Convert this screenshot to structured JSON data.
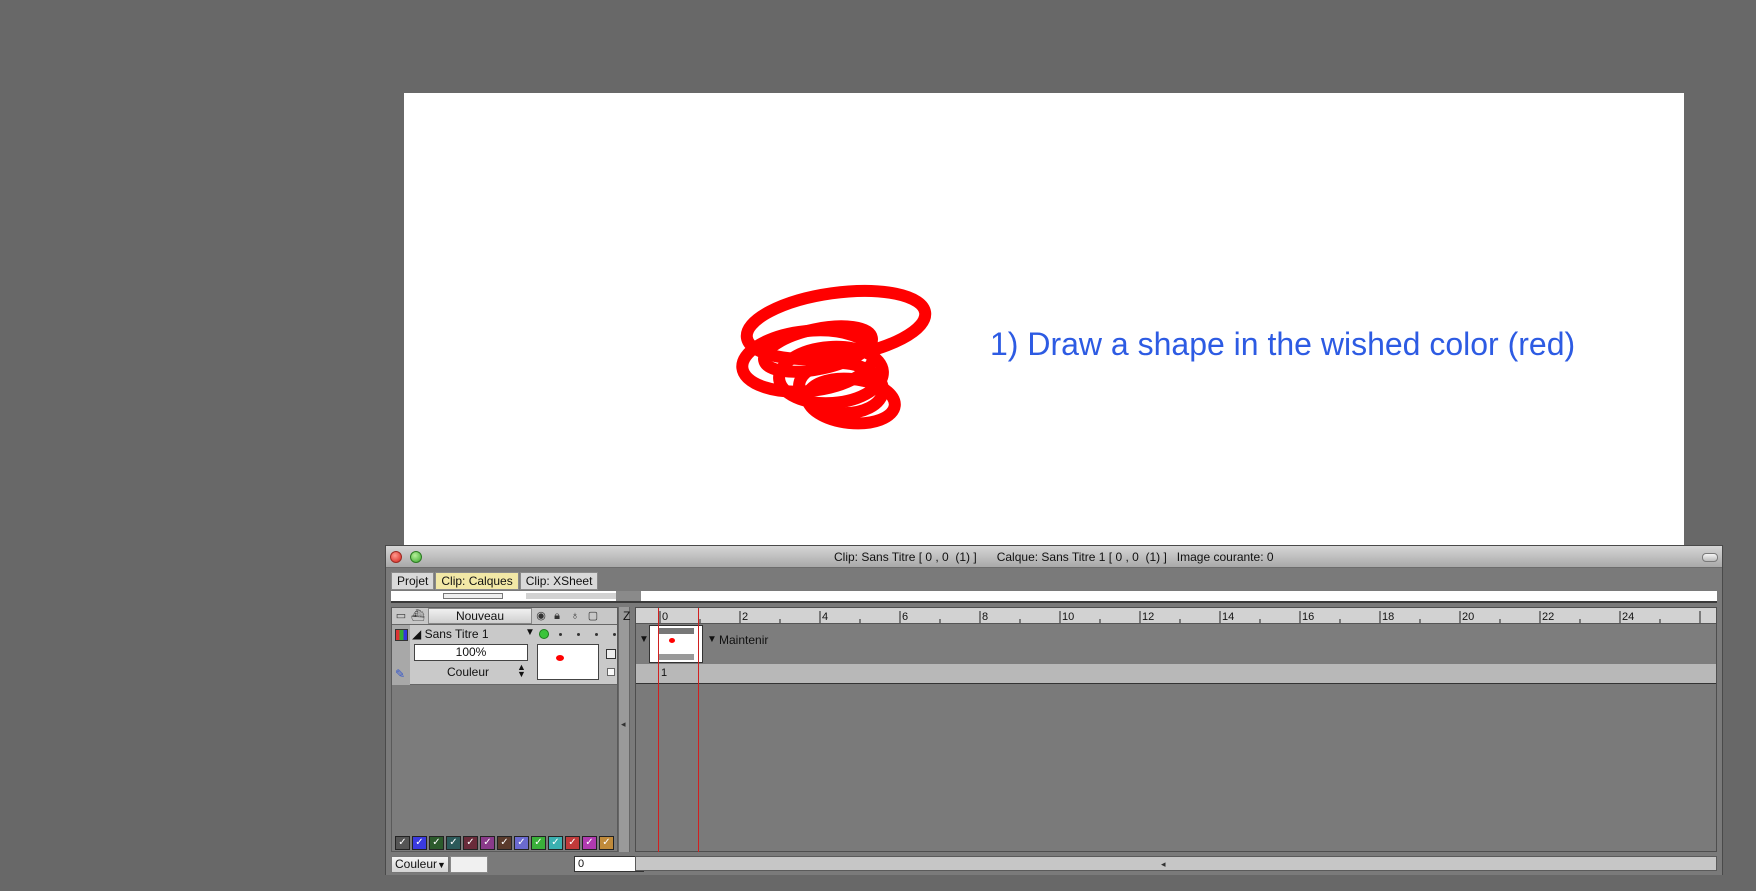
{
  "canvas": {
    "instruction": "1) Draw a shape in the wished color (red)",
    "instruction_color": "#2d5be3",
    "scribble_color": "#ff0000"
  },
  "window": {
    "title": "Clip: Sans Titre [ 0 , 0  (1) ]      Calque: Sans Titre 1 [ 0 , 0  (1) ]   Image courante: 0"
  },
  "tabs": [
    {
      "label": "Projet",
      "active": false
    },
    {
      "label": "Clip: Calques",
      "active": true
    },
    {
      "label": "Clip: XSheet",
      "active": false
    }
  ],
  "layers_toolbar": {
    "new_button": "Nouveau",
    "column_z": "Z",
    "icons": [
      "folder-icon",
      "layer-icon",
      "eye-icon",
      "lock-icon",
      "bulb-icon",
      "frame-icon"
    ]
  },
  "layer": {
    "name": "Sans Titre 1",
    "opacity": "100%",
    "blend_mode": "Couleur",
    "visible_color": "#3bc43b"
  },
  "swatches": [
    "#555555",
    "#3a3ae0",
    "#2b5a2b",
    "#2b5a5a",
    "#6a2b3a",
    "#8a3a8a",
    "#5a3a2b",
    "#6a6ad0",
    "#3ab03a",
    "#3ab0b0",
    "#c03a3a",
    "#b03ab0",
    "#c08a3a"
  ],
  "timeline": {
    "ruler_ticks": [
      "0",
      "2",
      "4",
      "6",
      "8",
      "10",
      "12",
      "14",
      "16",
      "18",
      "20",
      "22",
      "24"
    ],
    "hold_label": "Maintenir",
    "frame_number": "1",
    "cursor_color": "#d02020"
  },
  "bottom": {
    "color_mode": "Couleur",
    "frame_value": "0"
  }
}
